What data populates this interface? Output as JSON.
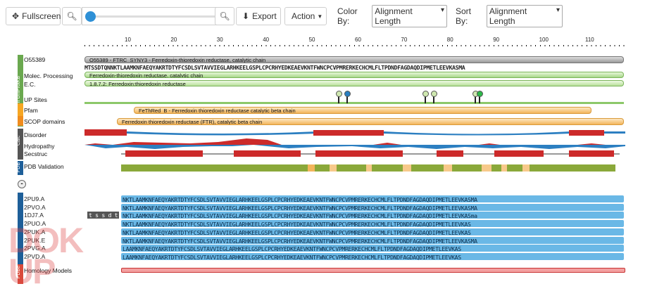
{
  "toolbar": {
    "fullscreen_label": "Fullscreen",
    "export_label": "Export",
    "action_label": "Action",
    "color_by_label": "Color By:",
    "color_by_value": "Alignment Length",
    "sort_by_label": "Sort By:",
    "sort_by_value": "Alignment Length"
  },
  "ruler": {
    "ticks": [
      "10",
      "20",
      "30",
      "40",
      "50",
      "60",
      "70",
      "80",
      "90",
      "100",
      "110"
    ]
  },
  "tracks": {
    "uniprot_id": "O55389",
    "uniprot_bar": "O55389 - FTRC_SYNY3 - Ferredoxin-thioredoxin reductase, catalytic chain",
    "sequence": "MTSSDTQNNKTLAAMKNFAEQYAKRTDTYFCSDLSVTAVVIEGLARHKEELGSPLCPCRHYEDKEAEVKNTFWNCPCVPMRERKECHCMLFLTPDNDFAGDAQDIPMETLEEVKASMA",
    "molec_label": "Molec. Processing",
    "molec_bar": "Ferredoxin-thioredoxin reductase, catalytic chain",
    "ec_label": "E.C.",
    "ec_bar": "1.8.7.2: Ferredoxin:thioredoxin reductase",
    "up_sites_label": "UP Sites",
    "pfam_label": "Pfam",
    "pfam_bar": "FeThRed_B - Ferredoxin thioredoxin reductase catalytic beta chain",
    "scop_label": "SCOP domains",
    "scop_bar": "Ferredoxin thioredoxin reductase (FTR), catalytic beta chain",
    "disorder_label": "Disorder",
    "hydropathy_label": "Hydropathy",
    "secstruc_label": "Secstruc",
    "pdbval_label": "PDB Validation",
    "homology_label": "Homology Models"
  },
  "side_groups": {
    "uniprot": "Pfam UniProtKB",
    "calc": "Calc",
    "pdb": "PDB",
    "pdbe": "PDBe"
  },
  "collapse_icon": "-",
  "pdb_rows": [
    {
      "id": "2PU9.A",
      "prefix": "",
      "seq": "NKTLAAMKNFAEQYAKRTDTYFCSDLSVTAVVIEGLARHKEELGSPLCPCRHYEDKEAEVKNTFWNCPCVPMRERKECHCMLFLTPDNDFAGDAQDIPMETLEEVKASMA"
    },
    {
      "id": "2PVO.A",
      "prefix": "",
      "seq": "NKTLAAMKNFAEQYAKRTDTYFCSDLSVTAVVIEGLARHKEELGSPLCPCRHYEDKEAEVKNTFWNCPCVPMRERKECHCMLFLTPDNDFAGDAQDIPMETLEEVKASMA"
    },
    {
      "id": "1DJ7.A",
      "prefix": "tssdt",
      "seq": "NKTLAAMKNFAEQYAKRTDTYFCSDLSVTAVVIEGLARHKEELGSPLCPCRHYEDKEAEVKNTFWNCPCVPMRERKECHCMLFLTPDNDFAGDAQDIPMETLEEVKASma"
    },
    {
      "id": "2PUO.A",
      "prefix": "",
      "seq": "NKTLAAMKNFAEQYAKRTDTYFCSDLSVTAVVIEGLARHKEELGSPLCPCRHYEDKEAEVKNTFWNCPCVPMRERKECHCMLFLTPDNDFAGDAQDIPMETLEEVKAS"
    },
    {
      "id": "2PUK.A",
      "prefix": "",
      "seq": "NKTLAAMKNFAEQYAKRTDTYFCSDLSVTAVVIEGLARHKEELGSPLCPCRHYEDKEAEVKNTFWNCPCVPMRERKECHCMLFLTPDNDFAGDAQDIPMETLEEVKAS"
    },
    {
      "id": "2PUK.E",
      "prefix": "",
      "seq": "NKTLAAMKNFAEQYAKRTDTYFCSDLSVTAVVIEGLARHKEELGSPLCPCRHYEDKEAEVKNTFWNCPCVPMRERKECHCMLFLTPDNDFAGDAQDIPMETLEEVKASMA"
    },
    {
      "id": "2PVG.A",
      "prefix": "",
      "seq": "LAAMKNFAEQYAKRTDTYFCSDLSVTAVVIEGLARHKEELGSPLCPCRHYEDKEAEVKNTFWNCPCVPMRERKECHCMLFLTPDNDFAGDAQDIPMETLEEVKAS"
    },
    {
      "id": "2PVD.A",
      "prefix": "",
      "seq": "LAAMKNFAEQYAKRTDTYFCSDLSVTAVVIEGLARHKEELGSPLCPCRHYEDKEAEVKNTFWNCPCVPMRERKECHCMLFLTPDNDFAGDAQDIPMETLEEVKAS"
    }
  ],
  "colors": {
    "uniprot_side": "#6aa84f",
    "pfam_side": "#f6a623",
    "scop_side": "#f08c1e",
    "calc_side": "#555555",
    "pdb_side": "#1e5f99",
    "pdbe_side": "#d94b3b",
    "disorder": "#2c7fc1",
    "disorder_high": "#cc2a2a",
    "seq_bar": "#6ab8e6"
  },
  "watermark": "DOK\nUP"
}
